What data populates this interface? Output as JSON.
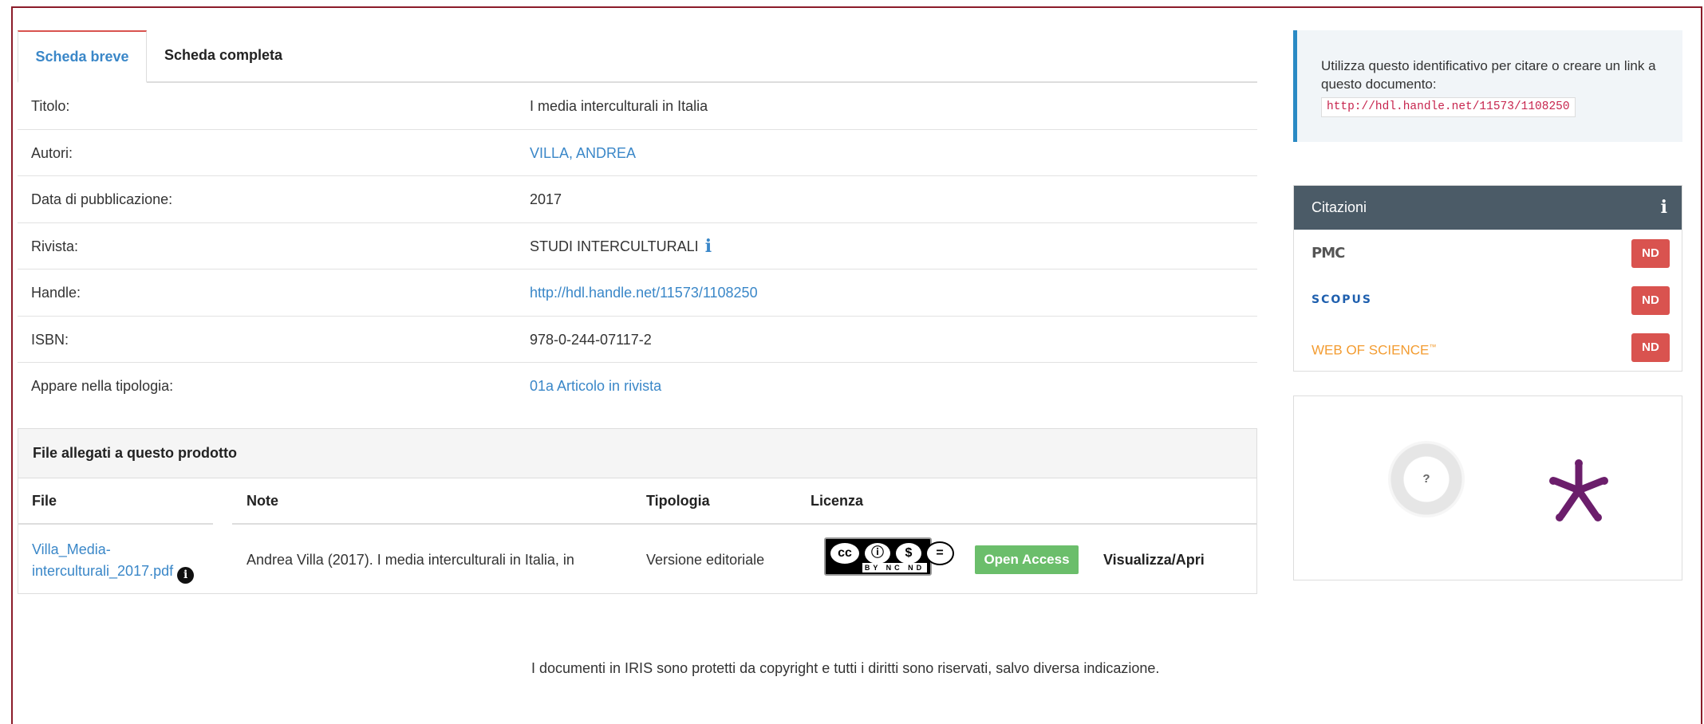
{
  "tabs": [
    {
      "label": "Scheda breve",
      "active": true
    },
    {
      "label": "Scheda completa",
      "active": false
    }
  ],
  "metadata": [
    {
      "label": "Titolo:",
      "value": "I media interculturali in Italia",
      "link": false
    },
    {
      "label": "Autori:",
      "value": "VILLA, ANDREA",
      "link": true
    },
    {
      "label": "Data di pubblicazione:",
      "value": "2017",
      "link": false
    },
    {
      "label": "Rivista:",
      "value": "STUDI INTERCULTURALI",
      "link": false,
      "info_icon": "info-icon"
    },
    {
      "label": "Handle:",
      "value": "http://hdl.handle.net/11573/1108250",
      "link": true
    },
    {
      "label": "ISBN:",
      "value": "978-0-244-07117-2",
      "link": false
    },
    {
      "label": "Appare nella tipologia:",
      "value": "01a Articolo in rivista",
      "link": true
    }
  ],
  "files": {
    "title": "File allegati a questo prodotto",
    "columns": [
      "File",
      "Note",
      "Tipologia",
      "Licenza"
    ],
    "rows": [
      {
        "file_line1": "Villa_Media-",
        "file_line2": "interculturali_2017.pdf",
        "note": "Andrea Villa (2017). I media interculturali in Italia, in",
        "tipologia": "Versione editoriale",
        "license": {
          "icons": [
            "cc",
            "by",
            "nc",
            "nd"
          ],
          "text": "BY NC ND"
        },
        "access": "Open Access",
        "action": "Visualizza/Apri"
      }
    ]
  },
  "footer_note": "I documenti in IRIS sono protetti da copyright e tutti i diritti sono riservati, salvo diversa indicazione.",
  "cite": {
    "text": "Utilizza questo identificativo per citare o creare un link a questo documento:",
    "url": "http://hdl.handle.net/11573/1108250"
  },
  "citazioni": {
    "title": "Citazioni",
    "sources": [
      {
        "name": "PMC",
        "value": "ND"
      },
      {
        "name": "SCOPUS",
        "value": "ND"
      },
      {
        "name": "WEB OF SCIENCE",
        "trademark": "™",
        "value": "ND"
      }
    ]
  },
  "altmetric": {
    "score": "?"
  },
  "colors": {
    "accent": "#3a87c8",
    "tab_active_border": "#d9534f",
    "nd_badge": "#d9534f",
    "open_access": "#5cb85c",
    "citazioni_header": "#4b5b67",
    "plumx": "#6b1e6b"
  }
}
